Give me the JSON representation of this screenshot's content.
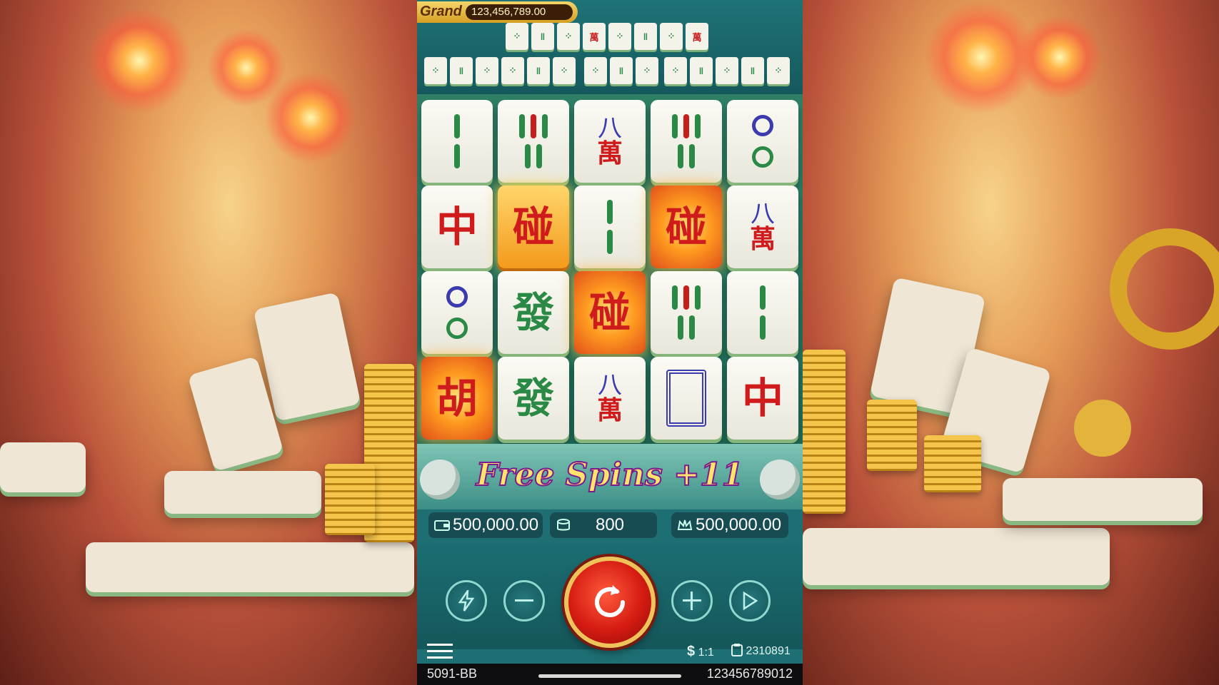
{
  "jackpot": {
    "label": "Grand",
    "value": "123,456,789.00"
  },
  "free_spins": {
    "text": "Free Spins +11"
  },
  "stats": {
    "balance": "500,000.00",
    "bet": "800",
    "win": "500,000.00"
  },
  "footer": {
    "currency_ratio": "1:1",
    "round_id": "2310891",
    "game_code": "5091-BB",
    "session_id": "123456789012"
  },
  "board": {
    "rows": [
      [
        "2-bamboo",
        "5-bamboo",
        "8-characters",
        "5-bamboo",
        "2-circles"
      ],
      [
        "red-dragon",
        "golden-peng",
        "2-bamboo",
        "burning-peng",
        "8-characters"
      ],
      [
        "2-circles",
        "green-dragon",
        "burning-peng",
        "5-bamboo",
        "2-bamboo"
      ],
      [
        "hu-wild",
        "green-dragon",
        "8-characters",
        "white-dragon",
        "red-dragon"
      ]
    ]
  },
  "glyphs": {
    "red_dragon": "中",
    "green_dragon": "發",
    "peng": "碰",
    "hu": "胡",
    "eight": "八",
    "wan": "萬"
  },
  "icons": {
    "menu": "menu-icon",
    "turbo": "lightning-icon",
    "minus": "minus-icon",
    "plus": "plus-icon",
    "spin": "refresh-icon",
    "autoplay": "play-icon",
    "wallet": "wallet-icon",
    "coins": "coins-icon",
    "crown": "crown-icon",
    "dollar": "dollar-icon",
    "clipboard": "clipboard-icon"
  },
  "colors": {
    "accent_gold": "#f0c35a",
    "spin_red": "#d51b12",
    "panel_teal": "#1e6f73"
  }
}
